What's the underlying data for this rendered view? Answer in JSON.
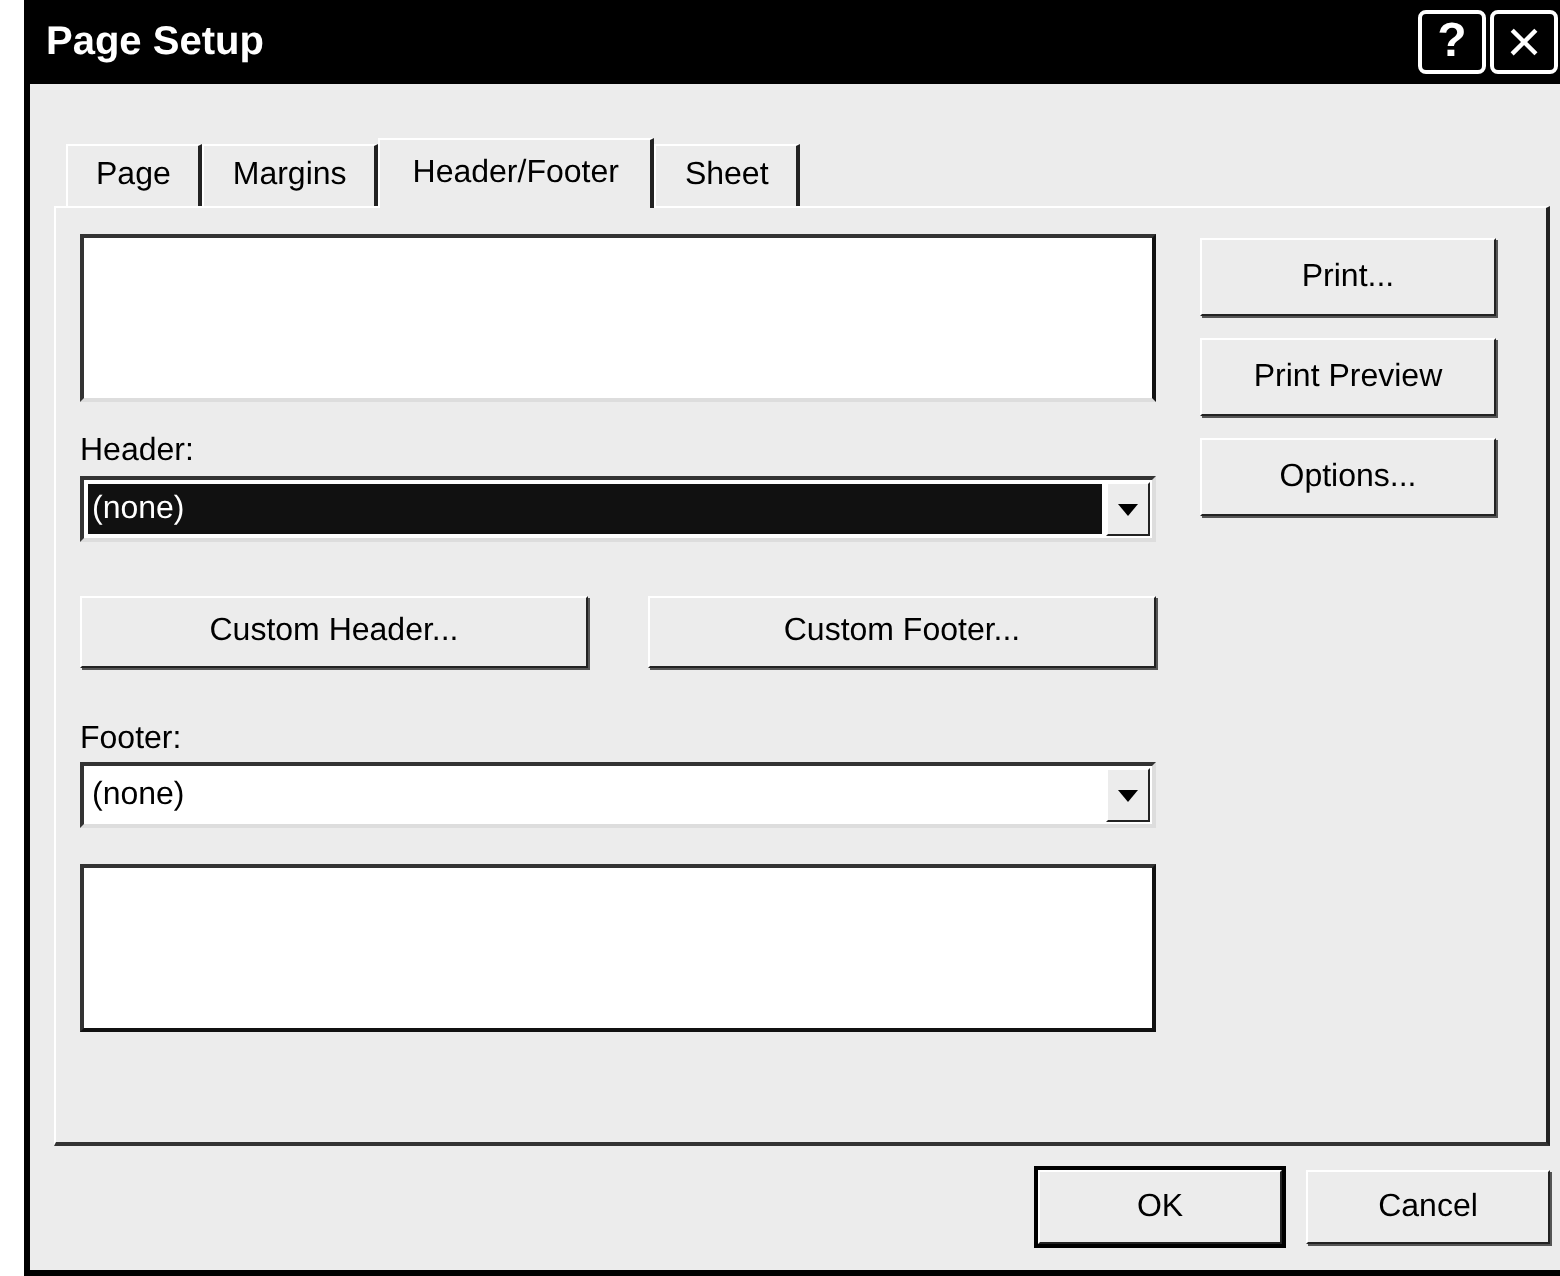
{
  "window": {
    "title": "Page Setup",
    "help_button": "?",
    "close_button": "×"
  },
  "tabs": [
    {
      "label": "Page",
      "selected": false
    },
    {
      "label": "Margins",
      "selected": false
    },
    {
      "label": "Header/Footer",
      "selected": true
    },
    {
      "label": "Sheet",
      "selected": false
    }
  ],
  "header": {
    "label": "Header:",
    "value": "(none)",
    "focused": true
  },
  "custom_buttons": [
    {
      "label": "Custom Header..."
    },
    {
      "label": "Custom Footer..."
    }
  ],
  "footer": {
    "label": "Footer:",
    "value": "(none)",
    "focused": false
  },
  "side_buttons": [
    {
      "label": "Print..."
    },
    {
      "label": "Print Preview"
    },
    {
      "label": "Options..."
    }
  ],
  "dialog_buttons": [
    {
      "label": "OK",
      "default": true
    },
    {
      "label": "Cancel",
      "default": false
    }
  ]
}
